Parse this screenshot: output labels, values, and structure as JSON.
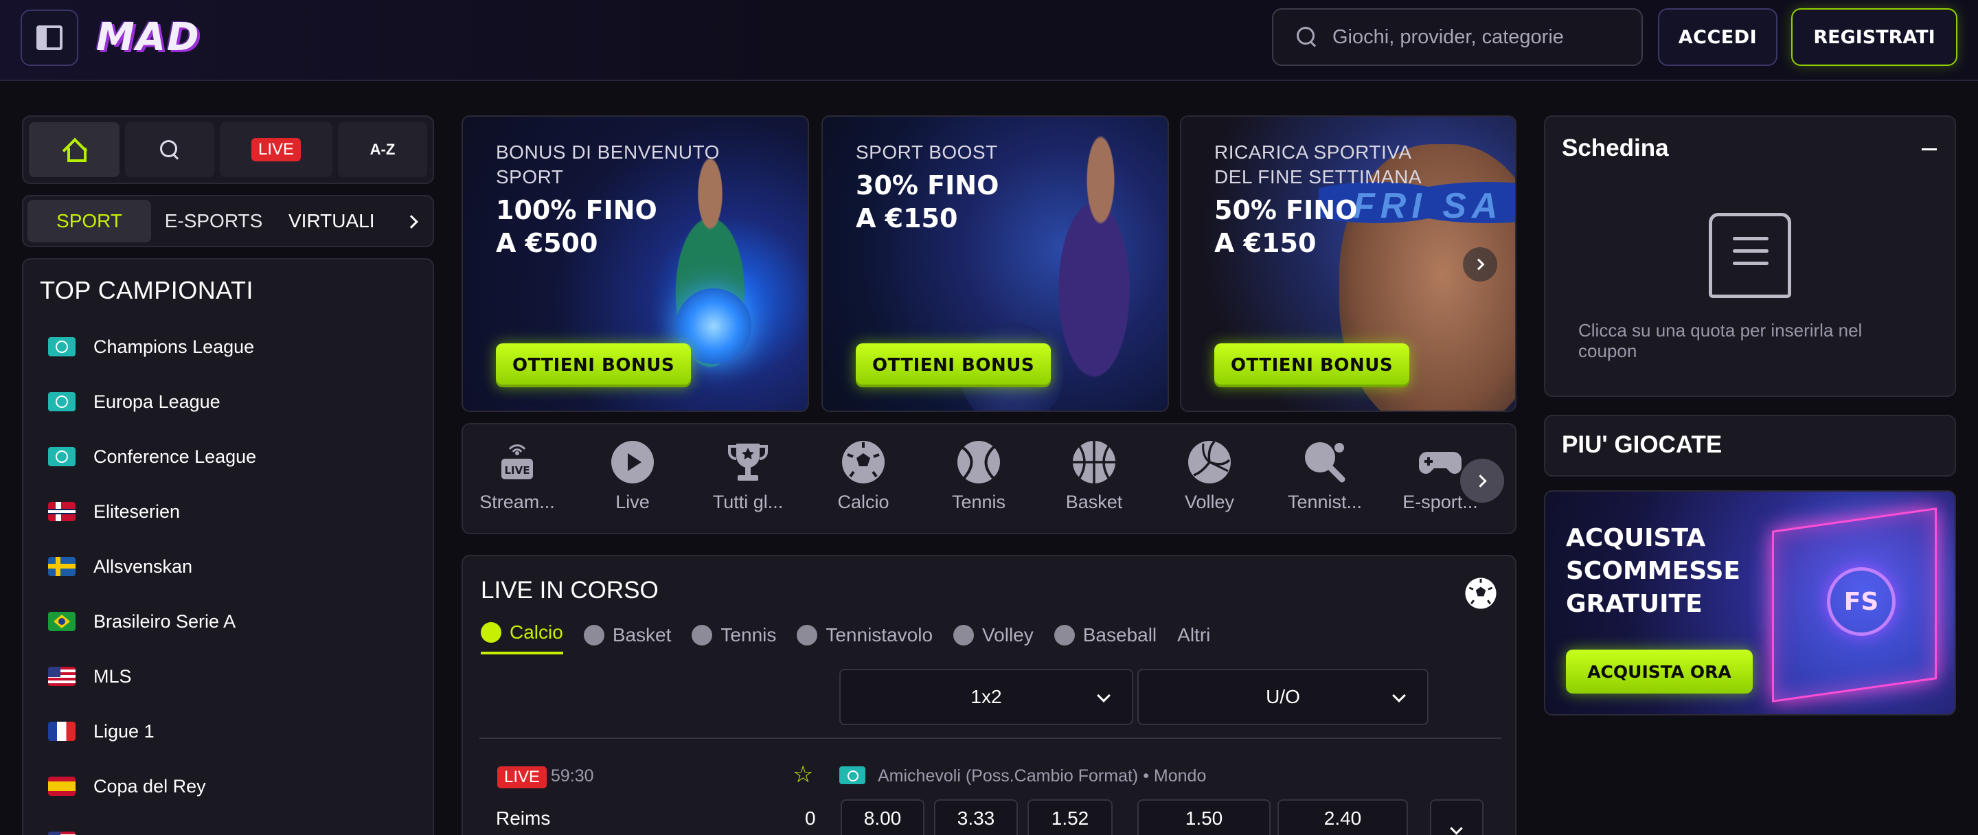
{
  "header": {
    "logo_text": "MAD",
    "search_placeholder": "Giochi, provider, categorie",
    "login_label": "ACCEDI",
    "register_label": "REGISTRATI"
  },
  "quick_nav": {
    "live_label": "LIVE",
    "az_label": "A-Z"
  },
  "sport_tabs": [
    {
      "label": "SPORT",
      "active": true
    },
    {
      "label": "E-SPORTS",
      "active": false
    },
    {
      "label": "VIRTUALI",
      "active": false
    }
  ],
  "top_leagues": {
    "title": "TOP CAMPIONATI",
    "items": [
      {
        "label": "Champions League",
        "flag": "globe-icon"
      },
      {
        "label": "Europa League",
        "flag": "globe-icon"
      },
      {
        "label": "Conference League",
        "flag": "globe-icon"
      },
      {
        "label": "Eliteserien",
        "flag": "norway-flag-icon"
      },
      {
        "label": "Allsvenskan",
        "flag": "sweden-flag-icon"
      },
      {
        "label": "Brasileiro Serie A",
        "flag": "brazil-flag-icon"
      },
      {
        "label": "MLS",
        "flag": "usa-flag-icon"
      },
      {
        "label": "Ligue 1",
        "flag": "france-flag-icon"
      },
      {
        "label": "Copa del Rey",
        "flag": "spain-flag-icon"
      }
    ]
  },
  "banners": [
    {
      "title": "BONUS DI BENVENUTO SPORT",
      "offer": "100% FINO A €500",
      "button": "OTTIENI BONUS"
    },
    {
      "title": "SPORT BOOST",
      "offer": "30% FINO A €150",
      "button": "OTTIENI BONUS"
    },
    {
      "title": "RICARICA SPORTIVA DEL FINE SETTIMANA",
      "offer": "50% FINO A €150",
      "button": "OTTIENI BONUS",
      "art_text": "FRI SA"
    }
  ],
  "sports": [
    {
      "label": "Stream...",
      "icon": "live-stream-icon",
      "badge": "LIVE"
    },
    {
      "label": "Live",
      "icon": "play-icon"
    },
    {
      "label": "Tutti gl...",
      "icon": "trophy-icon"
    },
    {
      "label": "Calcio",
      "icon": "soccer-ball-icon"
    },
    {
      "label": "Tennis",
      "icon": "tennis-ball-icon"
    },
    {
      "label": "Basket",
      "icon": "basketball-icon"
    },
    {
      "label": "Volley",
      "icon": "volleyball-icon"
    },
    {
      "label": "Tennist...",
      "icon": "table-tennis-icon"
    },
    {
      "label": "E-sport...",
      "icon": "gamepad-icon"
    }
  ],
  "live": {
    "title": "LIVE IN CORSO",
    "tabs": [
      {
        "label": "Calcio",
        "active": true,
        "icon": "soccer-ball-icon"
      },
      {
        "label": "Basket",
        "active": false,
        "icon": "basketball-icon"
      },
      {
        "label": "Tennis",
        "active": false,
        "icon": "tennis-ball-icon"
      },
      {
        "label": "Tennistavolo",
        "active": false,
        "icon": "table-tennis-icon"
      },
      {
        "label": "Volley",
        "active": false,
        "icon": "volleyball-icon"
      },
      {
        "label": "Baseball",
        "active": false,
        "icon": "baseball-icon"
      },
      {
        "label": "Altri",
        "active": false
      }
    ],
    "markets": [
      "1x2",
      "U/O"
    ],
    "match": {
      "live_badge": "LIVE",
      "time": "59:30",
      "competition": "Amichevoli (Poss.Cambio Format) • Mondo",
      "team": "Reims",
      "score": "0",
      "odds": [
        "8.00",
        "3.33",
        "1.52",
        "1.50",
        "2.40"
      ]
    }
  },
  "slip": {
    "title": "Schedina",
    "hint": "Clicca su una quota per inserirla nel coupon"
  },
  "popular": {
    "title": "PIU' GIOCATE"
  },
  "fs_banner": {
    "title": "ACQUISTA SCOMMESSE GRATUITE",
    "button": "ACQUISTA ORA",
    "coin_text": "FS"
  },
  "colors": {
    "accent": "#c6f000",
    "live_red": "#e0262b",
    "panel_bg": "#1a1922",
    "page_bg": "#0e0d14"
  }
}
